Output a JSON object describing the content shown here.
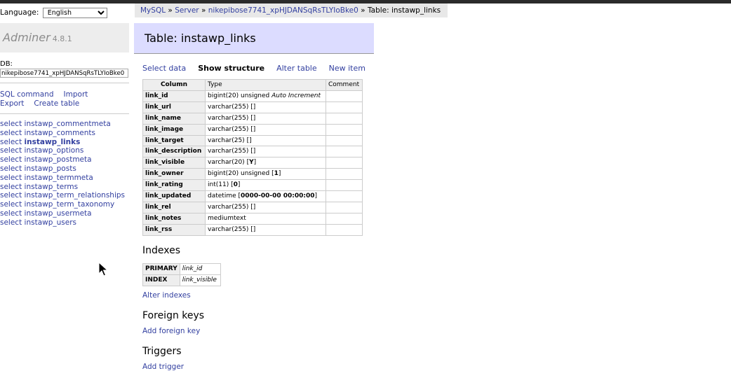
{
  "language": {
    "label": "Language:",
    "selected": "English"
  },
  "app": {
    "name": "Adminer",
    "version": "4.8.1"
  },
  "db": {
    "label": "DB:",
    "value": "nikepibose7741_xpHJDANSqRsTLYIoBke0"
  },
  "commands": {
    "sql": "SQL command",
    "import": "Import",
    "export": "Export",
    "create_table": "Create table"
  },
  "tables": [
    {
      "prefix": "select",
      "name": "instawp_commentmeta"
    },
    {
      "prefix": "select",
      "name": "instawp_comments"
    },
    {
      "prefix": "select",
      "name": "instawp_links",
      "current": true
    },
    {
      "prefix": "select",
      "name": "instawp_options"
    },
    {
      "prefix": "select",
      "name": "instawp_postmeta"
    },
    {
      "prefix": "select",
      "name": "instawp_posts"
    },
    {
      "prefix": "select",
      "name": "instawp_termmeta"
    },
    {
      "prefix": "select",
      "name": "instawp_terms"
    },
    {
      "prefix": "select",
      "name": "instawp_term_relationships"
    },
    {
      "prefix": "select",
      "name": "instawp_term_taxonomy"
    },
    {
      "prefix": "select",
      "name": "instawp_usermeta"
    },
    {
      "prefix": "select",
      "name": "instawp_users"
    }
  ],
  "breadcrumb": {
    "mysql": "MySQL",
    "sep": "»",
    "server": "Server",
    "database": "nikepibose7741_xpHJDANSqRsTLYIoBke0",
    "current": "Table: instawp_links"
  },
  "title": "Table: instawp_links",
  "actions": {
    "select": "Select data",
    "structure": "Show structure",
    "alter": "Alter table",
    "new": "New item"
  },
  "structure": {
    "headers": {
      "column": "Column",
      "type": "Type",
      "comment": "Comment"
    },
    "rows": [
      {
        "column": "link_id",
        "type": "bigint(20) unsigned",
        "extra": "Auto Increment",
        "default": ""
      },
      {
        "column": "link_url",
        "type": "varchar(255)",
        "default": "[]"
      },
      {
        "column": "link_name",
        "type": "varchar(255)",
        "default": "[]"
      },
      {
        "column": "link_image",
        "type": "varchar(255)",
        "default": "[]"
      },
      {
        "column": "link_target",
        "type": "varchar(25)",
        "default": "[]"
      },
      {
        "column": "link_description",
        "type": "varchar(255)",
        "default": "[]"
      },
      {
        "column": "link_visible",
        "type": "varchar(20)",
        "default": "Y"
      },
      {
        "column": "link_owner",
        "type": "bigint(20) unsigned",
        "default": "1"
      },
      {
        "column": "link_rating",
        "type": "int(11)",
        "default": "0"
      },
      {
        "column": "link_updated",
        "type": "datetime",
        "default": "0000-00-00 00:00:00"
      },
      {
        "column": "link_rel",
        "type": "varchar(255)",
        "default": "[]"
      },
      {
        "column": "link_notes",
        "type": "mediumtext",
        "default": ""
      },
      {
        "column": "link_rss",
        "type": "varchar(255)",
        "default": "[]"
      }
    ]
  },
  "indexes": {
    "heading": "Indexes",
    "rows": [
      {
        "type": "PRIMARY",
        "column": "link_id"
      },
      {
        "type": "INDEX",
        "column": "link_visible"
      }
    ],
    "alter_link": "Alter indexes"
  },
  "foreign_keys": {
    "heading": "Foreign keys",
    "add_link": "Add foreign key"
  },
  "triggers": {
    "heading": "Triggers",
    "add_link": "Add trigger"
  }
}
